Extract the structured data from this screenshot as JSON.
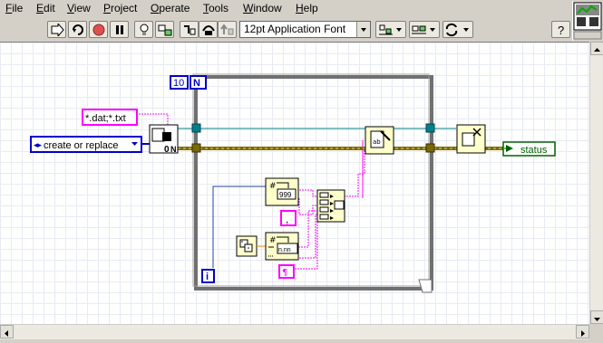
{
  "menu": {
    "items": [
      {
        "label": "File",
        "acc": "F",
        "rest": "ile"
      },
      {
        "label": "Edit",
        "acc": "E",
        "rest": "dit"
      },
      {
        "label": "View",
        "acc": "V",
        "rest": "iew"
      },
      {
        "label": "Project",
        "acc": "P",
        "rest": "roject"
      },
      {
        "label": "Operate",
        "acc": "O",
        "rest": "perate"
      },
      {
        "label": "Tools",
        "acc": "T",
        "rest": "ools"
      },
      {
        "label": "Window",
        "acc": "W",
        "rest": "indow"
      },
      {
        "label": "Help",
        "acc": "H",
        "rest": "elp"
      }
    ]
  },
  "toolbar": {
    "font_label": "12pt Application Font"
  },
  "diagram": {
    "loop_count": "10",
    "loop_count_terminal": "N",
    "iteration_terminal": "i",
    "file_pattern": "*.dat;*.txt",
    "operation_enum": "create or replace",
    "status_indicator": "status",
    "format_num_1": "999",
    "format_num_2": "n.nn",
    "comma_const": ",",
    "eol_const": "¶",
    "open_file_n": "0",
    "open_file_n2": "N"
  },
  "colors": {
    "background": "#d4d0c8",
    "grid_line": "#e8ebf5",
    "string_wire": "#ff00ff",
    "enum_wire": "#0000c8",
    "error_wire": "#7a6a00",
    "refnum_wire": "#00808a",
    "loop_border": "#808080",
    "node_fill": "#ffffcc"
  }
}
